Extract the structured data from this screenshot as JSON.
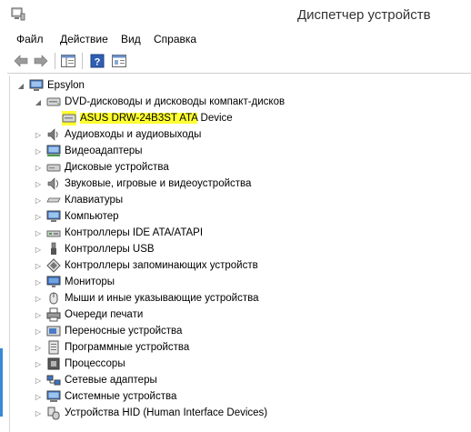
{
  "window": {
    "title": "Диспетчер устройств"
  },
  "menu": [
    "Файл",
    "Действие",
    "Вид",
    "Справка"
  ],
  "toolbar": {
    "buttons": [
      {
        "name": "back-button",
        "icon": "arrow-left-icon"
      },
      {
        "name": "forward-button",
        "icon": "arrow-right-icon"
      },
      {
        "name": "show-hide-tree-button",
        "icon": "console-tree-icon"
      },
      {
        "name": "help-button",
        "icon": "help-icon"
      },
      {
        "name": "properties-button",
        "icon": "properties-icon"
      }
    ]
  },
  "tree": {
    "root": "Epsylon",
    "dvd_category": "DVD-дисководы и дисководы компакт-дисков",
    "dvd_device_highlighted": "ASUS DRW-24B3ST ATA",
    "dvd_device_rest": " Device",
    "categories": [
      "Аудиовходы и аудиовыходы",
      "Видеоадаптеры",
      "Дисковые устройства",
      "Звуковые, игровые и видеоустройства",
      "Клавиатуры",
      "Компьютер",
      "Контроллеры IDE ATA/ATAPI",
      "Контроллеры USB",
      "Контроллеры запоминающих устройств",
      "Мониторы",
      "Мыши и иные указывающие устройства",
      "Очереди печати",
      "Переносные устройства",
      "Программные устройства",
      "Процессоры",
      "Сетевые адаптеры",
      "Системные устройства",
      "Устройства HID (Human Interface Devices)"
    ]
  },
  "colors": {
    "highlight": "#ffff33",
    "accent": "#3b88d6"
  }
}
